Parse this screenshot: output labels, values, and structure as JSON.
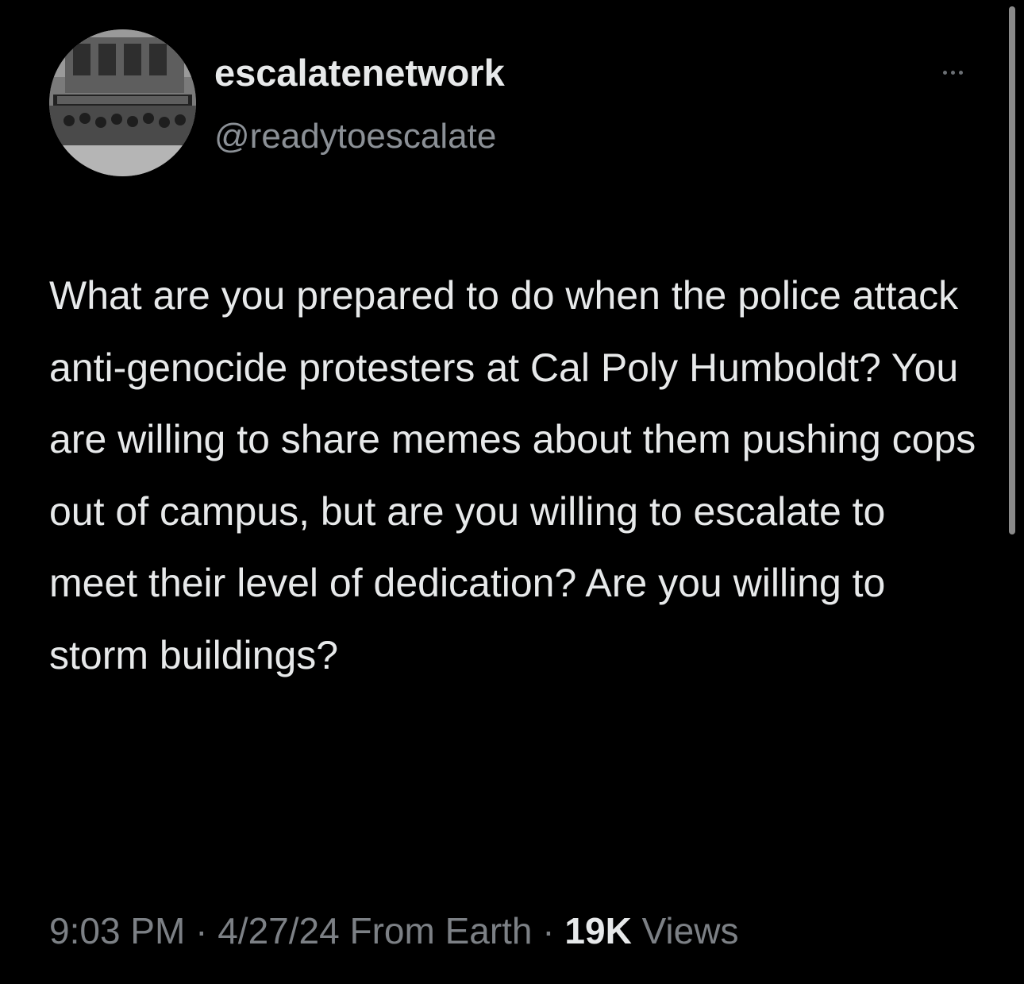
{
  "author": {
    "display_name": "escalatenetwork",
    "handle": "@readytoescalate",
    "avatar_icon": "profile-photo-protest-building"
  },
  "menu": {
    "icon": "more-options-icon"
  },
  "tweet": {
    "text": "What are you prepared to do when the police attack anti-genocide protesters at Cal Poly Humboldt? You are willing to share memes about them pushing cops out of campus, but are you willing to escalate to meet their level of dedication? Are you willing to storm buildings?"
  },
  "meta": {
    "time": "9:03 PM",
    "separator": "·",
    "date": "4/27/24",
    "source": "From Earth",
    "views_count": "19K",
    "views_label": "Views"
  },
  "colors": {
    "background": "#000000",
    "primary_text": "#e7e9ea",
    "secondary_text": "#7c8085"
  }
}
